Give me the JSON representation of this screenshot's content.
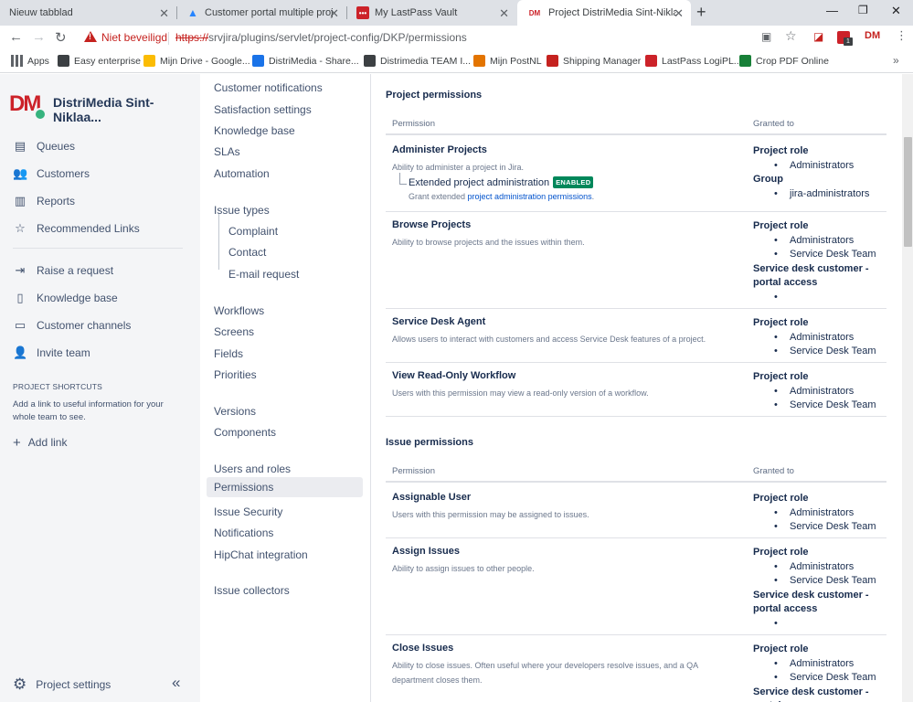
{
  "browser": {
    "tabs": [
      {
        "title": "Nieuw tabblad"
      },
      {
        "title": "Customer portal multiple project"
      },
      {
        "title": "My LastPass Vault"
      },
      {
        "title": "Project DistriMedia Sint-Niklaas",
        "favicon": "DM"
      }
    ],
    "not_secure": "Niet beveiligd",
    "url_scheme": "https://",
    "url_rest": "srvjira/plugins/servlet/project-config/DKP/permissions",
    "profile": "DM",
    "ext_badge": "1",
    "bookmarks": [
      {
        "label": "Apps",
        "color": "#5f6368"
      },
      {
        "label": "Easy enterprise",
        "color": "#3c4043"
      },
      {
        "label": "Mijn Drive - Google...",
        "color": "#fbbc04"
      },
      {
        "label": "DistriMedia - Share...",
        "color": "#1a73e8"
      },
      {
        "label": "Distrimedia TEAM I...",
        "color": "#3c4043"
      },
      {
        "label": "Mijn PostNL",
        "color": "#e37400"
      },
      {
        "label": "Shipping Manager",
        "color": "#c5221f"
      },
      {
        "label": "LastPass LogiPL...",
        "color": "#cc2229"
      },
      {
        "label": "Crop PDF Online",
        "color": "#188038"
      }
    ]
  },
  "project": {
    "logo": "DM",
    "name": "DistriMedia Sint-Niklaa..."
  },
  "sidebar": {
    "items": [
      {
        "label": "Queues",
        "icon": "queues-icon",
        "glyph": "▤"
      },
      {
        "label": "Customers",
        "icon": "customers-icon",
        "glyph": "👥"
      },
      {
        "label": "Reports",
        "icon": "reports-icon",
        "glyph": "▥"
      },
      {
        "label": "Recommended Links",
        "icon": "star-icon",
        "glyph": "☆"
      },
      {
        "label": "Raise a request",
        "icon": "raise-request-icon",
        "glyph": "⇥"
      },
      {
        "label": "Knowledge base",
        "icon": "document-icon",
        "glyph": "▯"
      },
      {
        "label": "Customer channels",
        "icon": "monitor-icon",
        "glyph": "▭"
      },
      {
        "label": "Invite team",
        "icon": "invite-user-icon",
        "glyph": "👤"
      }
    ],
    "shortcuts_heading": "PROJECT SHORTCUTS",
    "shortcuts_text": "Add a link to useful information for your whole team to see.",
    "add_link": "Add link",
    "project_settings": "Project settings"
  },
  "subnav": {
    "items": [
      {
        "label": "Customer notifications",
        "child": false
      },
      {
        "label": "Satisfaction settings",
        "child": false
      },
      {
        "label": "Knowledge base",
        "child": false
      },
      {
        "label": "SLAs",
        "child": false
      },
      {
        "label": "Automation",
        "child": false
      },
      {
        "label": "Issue types",
        "child": false
      },
      {
        "label": "Complaint",
        "child": true
      },
      {
        "label": "Contact",
        "child": true
      },
      {
        "label": "E-mail request",
        "child": true
      },
      {
        "label": "Workflows",
        "child": false
      },
      {
        "label": "Screens",
        "child": false
      },
      {
        "label": "Fields",
        "child": false
      },
      {
        "label": "Priorities",
        "child": false
      },
      {
        "label": "Versions",
        "child": false
      },
      {
        "label": "Components",
        "child": false
      },
      {
        "label": "Users and roles",
        "child": false
      },
      {
        "label": "Permissions",
        "child": false,
        "selected": true
      },
      {
        "label": "Issue Security",
        "child": false
      },
      {
        "label": "Notifications",
        "child": false
      },
      {
        "label": "HipChat integration",
        "child": false
      },
      {
        "label": "Issue collectors",
        "child": false
      }
    ]
  },
  "permissions": {
    "col_permission": "Permission",
    "col_granted": "Granted to",
    "sections": [
      {
        "title": "Project permissions",
        "rows": [
          {
            "name": "Administer Projects",
            "desc": "Ability to administer a project in Jira.",
            "extended": {
              "title": "Extended project administration",
              "badge": "ENABLED",
              "desc_prefix": "Grant extended ",
              "desc_link": "project administration permissions",
              "desc_suffix": "."
            },
            "grants": [
              {
                "type": "Project role",
                "items": [
                  "Administrators"
                ]
              },
              {
                "type": "Group",
                "items": [
                  "jira-administrators"
                ]
              }
            ]
          },
          {
            "name": "Browse Projects",
            "desc": "Ability to browse projects and the issues within them.",
            "grants": [
              {
                "type": "Project role",
                "items": [
                  "Administrators",
                  "Service Desk Team"
                ]
              },
              {
                "type": "Service desk customer - portal access",
                "items": [
                  ""
                ]
              }
            ]
          },
          {
            "name": "Service Desk Agent",
            "desc": "Allows users to interact with customers and access Service Desk features of a project.",
            "grants": [
              {
                "type": "Project role",
                "items": [
                  "Administrators",
                  "Service Desk Team"
                ]
              }
            ]
          },
          {
            "name": "View Read-Only Workflow",
            "desc": "Users with this permission may view a read-only version of a workflow.",
            "grants": [
              {
                "type": "Project role",
                "items": [
                  "Administrators",
                  "Service Desk Team"
                ]
              }
            ]
          }
        ]
      },
      {
        "title": "Issue permissions",
        "rows": [
          {
            "name": "Assignable User",
            "desc": "Users with this permission may be assigned to issues.",
            "grants": [
              {
                "type": "Project role",
                "items": [
                  "Administrators",
                  "Service Desk Team"
                ]
              }
            ]
          },
          {
            "name": "Assign Issues",
            "desc": "Ability to assign issues to other people.",
            "grants": [
              {
                "type": "Project role",
                "items": [
                  "Administrators",
                  "Service Desk Team"
                ]
              },
              {
                "type": "Service desk customer - portal access",
                "items": [
                  ""
                ]
              }
            ]
          },
          {
            "name": "Close Issues",
            "desc": "Ability to close issues. Often useful where your developers resolve issues, and a QA department closes them.",
            "grants": [
              {
                "type": "Project role",
                "items": [
                  "Administrators",
                  "Service Desk Team"
                ]
              },
              {
                "type": "Service desk customer - portal access",
                "items": []
              }
            ]
          }
        ]
      }
    ]
  }
}
